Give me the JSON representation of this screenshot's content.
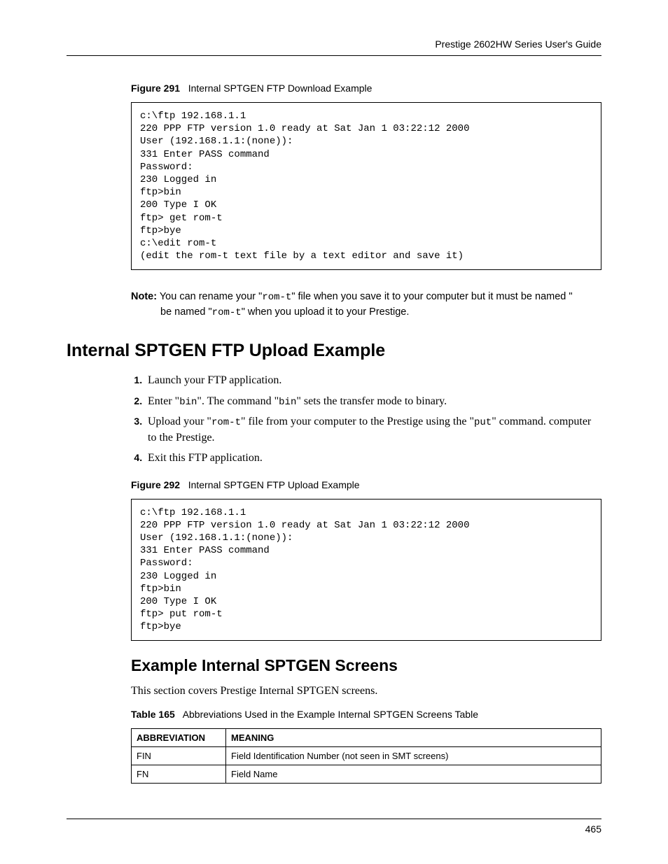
{
  "header": {
    "guide_title": "Prestige 2602HW Series User's Guide"
  },
  "figure291": {
    "label": "Figure 291",
    "caption": "Internal SPTGEN FTP Download Example",
    "code": "c:\\ftp 192.168.1.1\n220 PPP FTP version 1.0 ready at Sat Jan 1 03:22:12 2000\nUser (192.168.1.1:(none)):\n331 Enter PASS command\nPassword:\n230 Logged in\nftp>bin\n200 Type I OK\nftp> get rom-t\nftp>bye\nc:\\edit rom-t\n(edit the rom-t text file by a text editor and save it)"
  },
  "note": {
    "label": "Note:",
    "pre1": " You can rename your \"",
    "code1": "rom-t",
    "mid1": "\" file when you save it to your computer but it must be named \"",
    "code2": "rom-t",
    "post1": "\" when you upload it to your Prestige."
  },
  "section_upload": {
    "heading": "Internal SPTGEN FTP Upload Example",
    "steps": {
      "s1": "Launch your FTP application.",
      "s2_pre": "Enter \"",
      "s2_c1": "bin",
      "s2_mid": "\". The command \"",
      "s2_c2": "bin",
      "s2_post": "\" sets the transfer mode to binary.",
      "s3_pre": "Upload your \"",
      "s3_c1": "rom-t",
      "s3_mid": "\" file from your computer to the Prestige using the \"",
      "s3_c2": "put",
      "s3_post": "\" command. computer to the Prestige.",
      "s4": "Exit this FTP application."
    }
  },
  "figure292": {
    "label": "Figure 292",
    "caption": "Internal SPTGEN FTP Upload Example",
    "code": "c:\\ftp 192.168.1.1\n220 PPP FTP version 1.0 ready at Sat Jan 1 03:22:12 2000\nUser (192.168.1.1:(none)):\n331 Enter PASS command\nPassword:\n230 Logged in\nftp>bin\n200 Type I OK\nftp> put rom-t\nftp>bye"
  },
  "section_screens": {
    "heading": "Example Internal SPTGEN Screens",
    "intro": "This section covers Prestige Internal SPTGEN screens."
  },
  "table165": {
    "label": "Table 165",
    "caption": "Abbreviations Used in the Example Internal SPTGEN Screens Table",
    "headers": {
      "c0": "ABBREVIATION",
      "c1": "MEANING"
    },
    "rows": [
      {
        "c0": "FIN",
        "c1": "Field Identification Number (not seen in SMT screens)"
      },
      {
        "c0": "FN",
        "c1": "Field Name"
      }
    ]
  },
  "footer": {
    "page_number": "465"
  }
}
